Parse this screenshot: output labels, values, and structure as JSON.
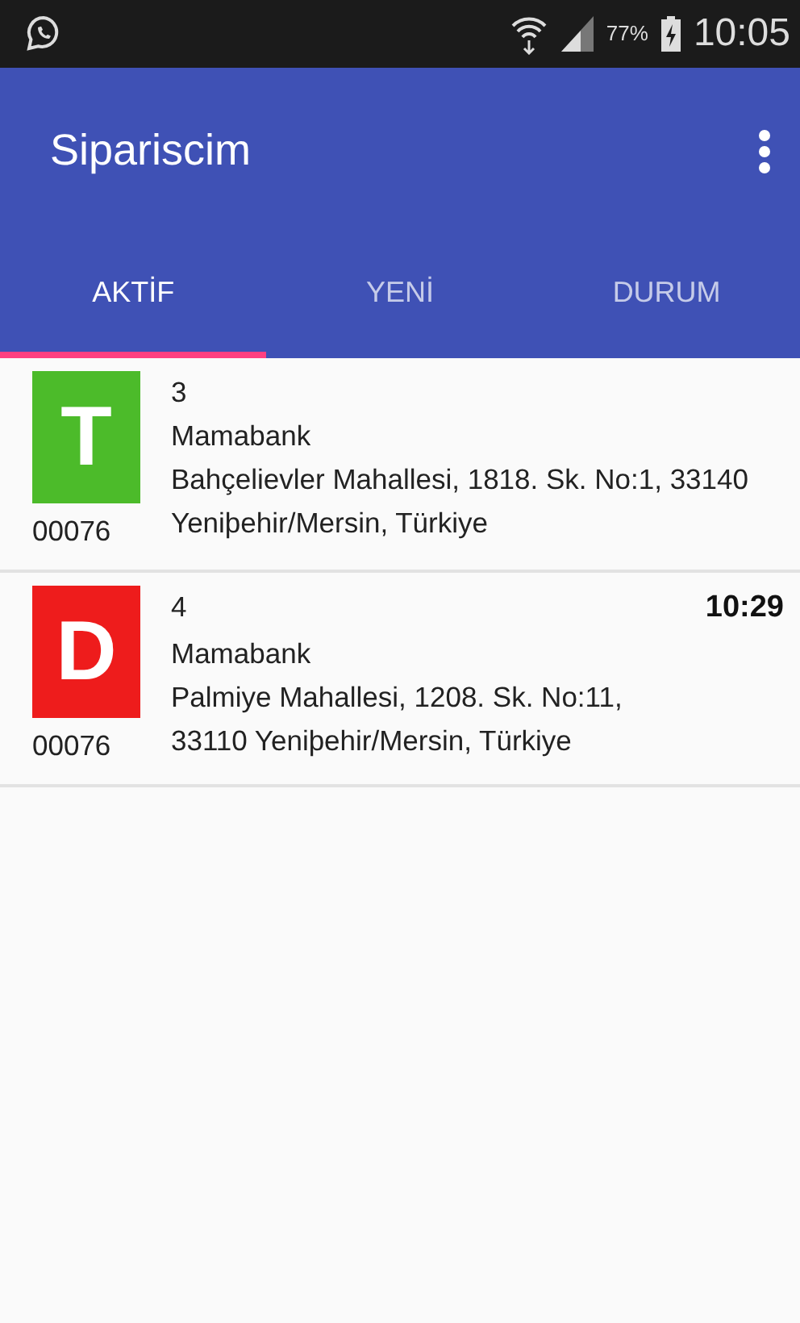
{
  "status_bar": {
    "battery": "77%",
    "time": "10:05"
  },
  "app_bar": {
    "title": "Sipariscim"
  },
  "tabs": [
    {
      "label": "AKTİF",
      "selected": true
    },
    {
      "label": "YENİ",
      "selected": false
    },
    {
      "label": "DURUM",
      "selected": false
    }
  ],
  "orders": [
    {
      "letter": "T",
      "color": "#4cbb2a",
      "code": "00076",
      "number": "3",
      "name": "Mamabank",
      "address": [
        "Bahçelievler Mahallesi, 1818. Sk. No:1, 33140",
        "Yeniþehir/Mersin, Türkiye"
      ]
    },
    {
      "letter": "D",
      "color": "#ee1c1c",
      "code": "00076",
      "number": "4",
      "name": "Mamabank",
      "address": [
        "Palmiye Mahallesi, 1208. Sk. No:11,",
        "33110 Yeniþehir/Mersin, Türkiye"
      ],
      "time": "10:29"
    }
  ]
}
